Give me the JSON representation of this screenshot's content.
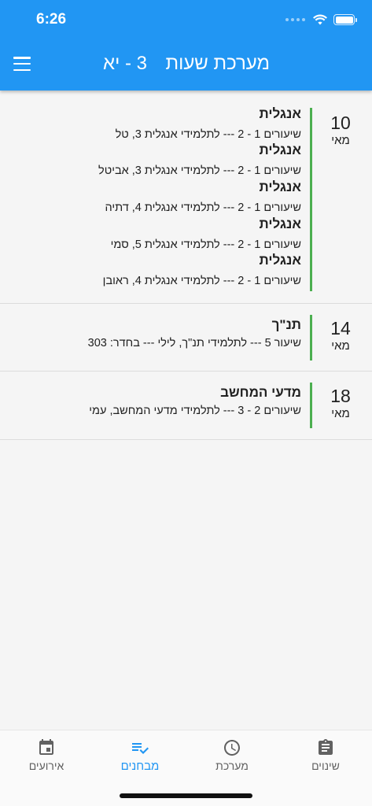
{
  "status_bar": {
    "time": "6:26"
  },
  "appbar": {
    "title": "מערכת שעות",
    "class_label": "3 - יא"
  },
  "days": [
    {
      "day": "10",
      "month": "מאי",
      "exams": [
        {
          "subject": "אנגלית",
          "detail": "שיעורים 1 - 2 --- לתלמידי אנגלית 3, טל"
        },
        {
          "subject": "אנגלית",
          "detail": "שיעורים 1 - 2 --- לתלמידי אנגלית 3, אביטל"
        },
        {
          "subject": "אנגלית",
          "detail": "שיעורים 1 - 2 --- לתלמידי אנגלית 4, דתיה"
        },
        {
          "subject": "אנגלית",
          "detail": "שיעורים 1 - 2 --- לתלמידי אנגלית 5, סמי"
        },
        {
          "subject": "אנגלית",
          "detail": "שיעורים 1 - 2 --- לתלמידי אנגלית 4, ראובן"
        }
      ]
    },
    {
      "day": "14",
      "month": "מאי",
      "exams": [
        {
          "subject": "תנ\"ך",
          "detail": "שיעור 5 --- לתלמידי תנ\"ך, לילי --- בחדר: 303"
        }
      ]
    },
    {
      "day": "18",
      "month": "מאי",
      "exams": [
        {
          "subject": "מדעי המחשב",
          "detail": "שיעורים 2 - 3 --- לתלמידי מדעי המחשב, עמי"
        }
      ]
    }
  ],
  "bottom_nav": {
    "items": [
      {
        "label": "אירועים",
        "icon": "calendar-event-icon"
      },
      {
        "label": "מבחנים",
        "icon": "playlist-check-icon"
      },
      {
        "label": "מערכת",
        "icon": "clock-icon"
      },
      {
        "label": "שינוים",
        "icon": "clipboard-icon"
      }
    ],
    "active_index": 1
  },
  "colors": {
    "primary": "#2196f3",
    "accent_bar": "#4caf50"
  }
}
